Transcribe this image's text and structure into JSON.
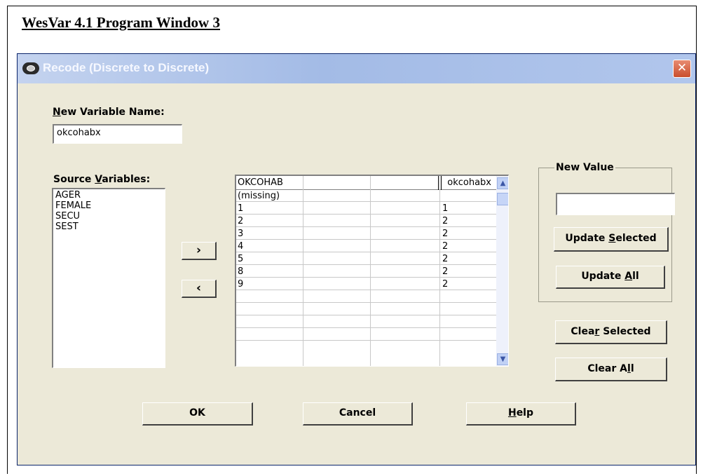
{
  "doc": {
    "title": "WesVar 4.1 Program Window 3"
  },
  "window": {
    "title": "Recode (Discrete to Discrete)",
    "close_glyph": "✕"
  },
  "new_variable": {
    "label_u": "N",
    "label_rest": "ew Variable Name:",
    "value": "okcohabx"
  },
  "source": {
    "label_pre": "Source ",
    "label_u": "V",
    "label_post": "ariables:",
    "items": [
      "AGER",
      "FEMALE",
      "SECU",
      "SEST"
    ]
  },
  "move_buttons": {
    "add": "›",
    "remove": "‹"
  },
  "grid": {
    "headers": [
      "OKCOHAB",
      "",
      "",
      "okcohabx"
    ],
    "rows": [
      [
        "(missing)",
        "",
        "",
        ""
      ],
      [
        "1",
        "",
        "",
        "1"
      ],
      [
        "2",
        "",
        "",
        "2"
      ],
      [
        "3",
        "",
        "",
        "2"
      ],
      [
        "4",
        "",
        "",
        "2"
      ],
      [
        "5",
        "",
        "",
        "2"
      ],
      [
        "8",
        "",
        "",
        "2"
      ],
      [
        "9",
        "",
        "",
        "2"
      ],
      [
        "",
        "",
        "",
        ""
      ],
      [
        "",
        "",
        "",
        ""
      ],
      [
        "",
        "",
        "",
        ""
      ],
      [
        "",
        "",
        "",
        ""
      ]
    ],
    "scroll_up": "▲",
    "scroll_down": "▼"
  },
  "new_value": {
    "label": "New Value",
    "value": "",
    "update_selected_pre": "Update ",
    "update_selected_u": "S",
    "update_selected_post": "elected",
    "update_all_pre": "Update ",
    "update_all_u": "A",
    "update_all_post": "ll"
  },
  "clear": {
    "selected_pre": "Clea",
    "selected_u": "r",
    "selected_post": " Selected",
    "all_pre": "Clear A",
    "all_u": "l",
    "all_post": "l"
  },
  "footer": {
    "ok": "OK",
    "cancel": "Cancel",
    "help_u": "H",
    "help_post": "elp"
  }
}
